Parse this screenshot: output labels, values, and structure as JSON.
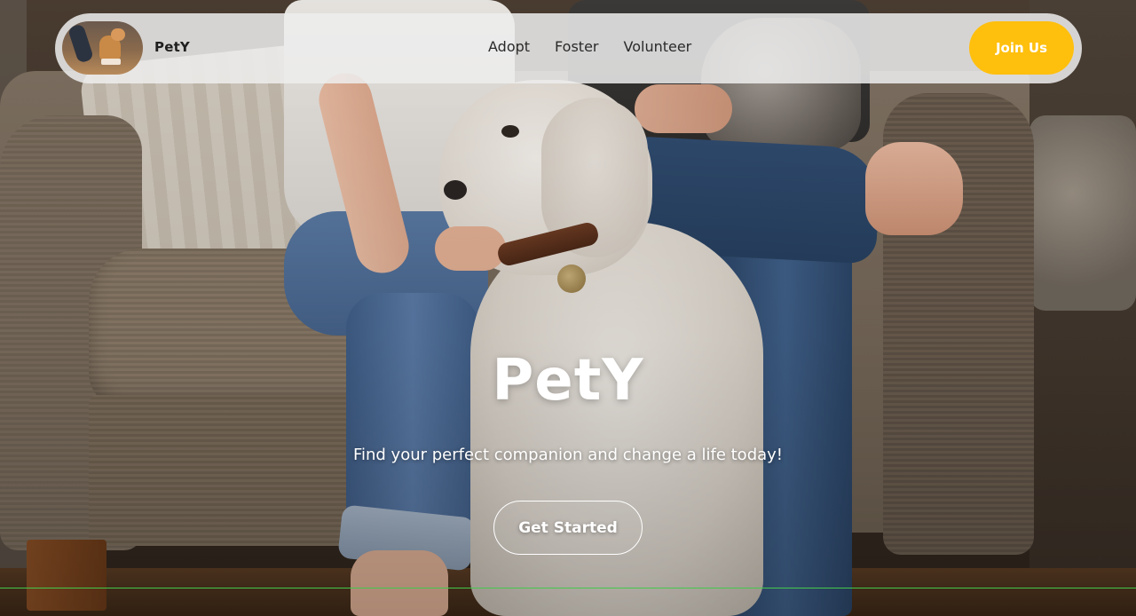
{
  "brand": {
    "name": "PetY",
    "logo_icon": "corgi-photo-icon"
  },
  "nav": {
    "links": [
      {
        "label": "Adopt"
      },
      {
        "label": "Foster"
      },
      {
        "label": "Volunteer"
      }
    ],
    "join_label": "Join Us"
  },
  "hero": {
    "title": "PetY",
    "subtitle": "Find your perfect companion and change a life today!",
    "cta_label": "Get Started"
  },
  "colors": {
    "accent": "#ffbf0d",
    "navbar_bg": "#eeeeee",
    "text_on_hero": "#ffffff"
  }
}
